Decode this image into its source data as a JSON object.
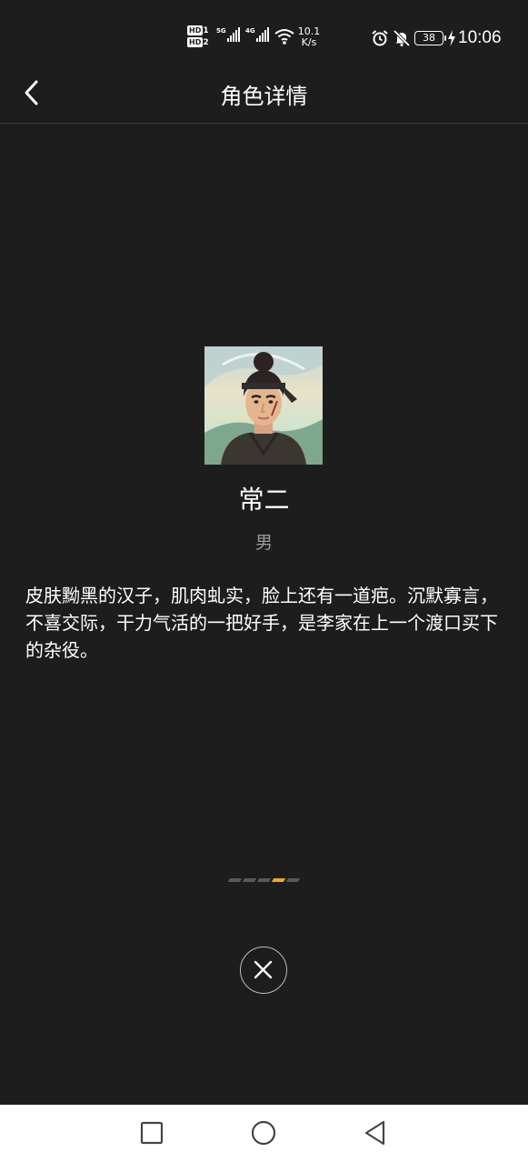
{
  "status_bar": {
    "hd1": "HD",
    "hd1_sim": "1",
    "hd2": "HD",
    "hd2_sim": "2",
    "net1": "5G",
    "net2": "4G",
    "speed_value": "10.1",
    "speed_unit": "K/s",
    "battery": "38",
    "time": "10:06",
    "icons": [
      "signal-icon",
      "wifi-icon",
      "alarm-icon",
      "mute-icon",
      "battery-icon",
      "charging-icon"
    ]
  },
  "header": {
    "title": "角色详情",
    "back_icon": "chevron-left-icon"
  },
  "character": {
    "name": "常二",
    "gender": "男",
    "description": "皮肤黝黑的汉子，肌肉虬实，脸上还有一道疤。沉默寡言，不喜交际，干力气活的一把好手，是李家在上一个渡口买下的杂役。"
  },
  "pager": {
    "total": 5,
    "active_index": 3,
    "active_color": "#f0a623",
    "inactive_color": "#5a5a5a"
  },
  "close_icon": "close-icon",
  "nav_bar": {
    "icons": [
      "recent-apps-icon",
      "home-icon",
      "back-icon"
    ]
  }
}
